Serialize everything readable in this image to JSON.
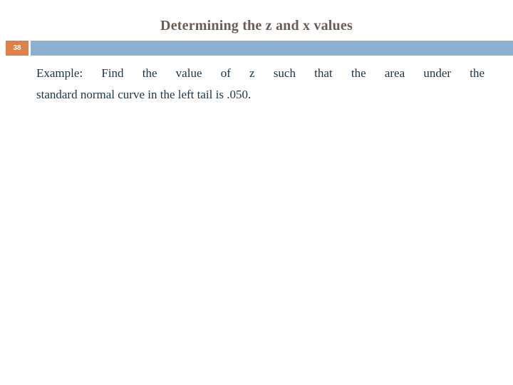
{
  "slide": {
    "title": "Determining the z and x values",
    "number_badge": "38",
    "body": {
      "line_1": "Example: Find the value of z such that the area under the",
      "line_2": "standard normal curve in the left tail is .050."
    }
  },
  "colors": {
    "title_text": "#6b5d57",
    "badge_background": "#dd8149",
    "badge_text": "#ffffff",
    "banner_bar": "#8cb0d2",
    "body_text": "#1d3448",
    "page_background": "#ffffff"
  }
}
